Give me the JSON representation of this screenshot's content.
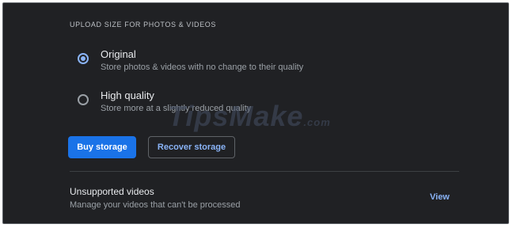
{
  "section": {
    "title": "UPLOAD SIZE FOR PHOTOS & VIDEOS"
  },
  "options": [
    {
      "title": "Original",
      "description": "Store photos & videos with no change to their quality",
      "selected": true
    },
    {
      "title": "High quality",
      "description": "Store more at a slightly reduced quality",
      "selected": false
    }
  ],
  "buttons": {
    "buy_storage": "Buy storage",
    "recover_storage": "Recover storage"
  },
  "unsupported": {
    "title": "Unsupported videos",
    "description": "Manage your videos that can't be processed",
    "link": "View"
  },
  "watermark": {
    "text": "TipsMake",
    "suffix": ".com"
  },
  "colors": {
    "background": "#202124",
    "accent": "#8ab4f8",
    "primary_button": "#1a73e8"
  },
  "icons": [
    "radio-checked-icon",
    "radio-unchecked-icon"
  ]
}
